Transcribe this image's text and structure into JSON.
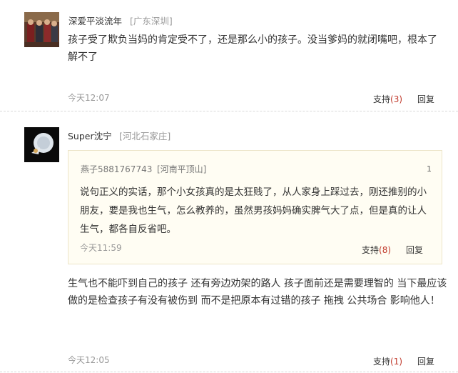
{
  "comments": [
    {
      "username": "深爱平淡流年",
      "location": "[广东深圳]",
      "content": "孩子受了欺负当妈的肯定受不了，还是那么小的孩子。没当爹妈的就闭嘴吧，根本了解不了",
      "time": "今天12:07",
      "support_label": "支持",
      "support_count": "(3)",
      "reply_label": "回复"
    },
    {
      "username": "Super沈宁",
      "location": "[河北石家庄]",
      "quote": {
        "username": "燕子5881767743",
        "location": "[河南平顶山]",
        "floor": "1",
        "content": "说句正义的实话，那个小女孩真的是太狂贱了，从人家身上踩过去，刚还推别的小朋友，要是我也生气，怎么教养的，虽然男孩妈妈确实脾气大了点，但是真的让人生气，都各自反省吧。",
        "time": "今天11:59",
        "support_label": "支持",
        "support_count": "(8)",
        "reply_label": "回复"
      },
      "content": "生气也不能吓到自己的孩子 还有旁边劝架的路人 孩子面前还是需要理智的 当下最应该做的是检查孩子有没有被伤到 而不是把原本有过错的孩子 拖拽 公共场合 影响他人！",
      "time": "今天12:05",
      "support_label": "支持",
      "support_count": "(1)",
      "reply_label": "回复"
    }
  ]
}
